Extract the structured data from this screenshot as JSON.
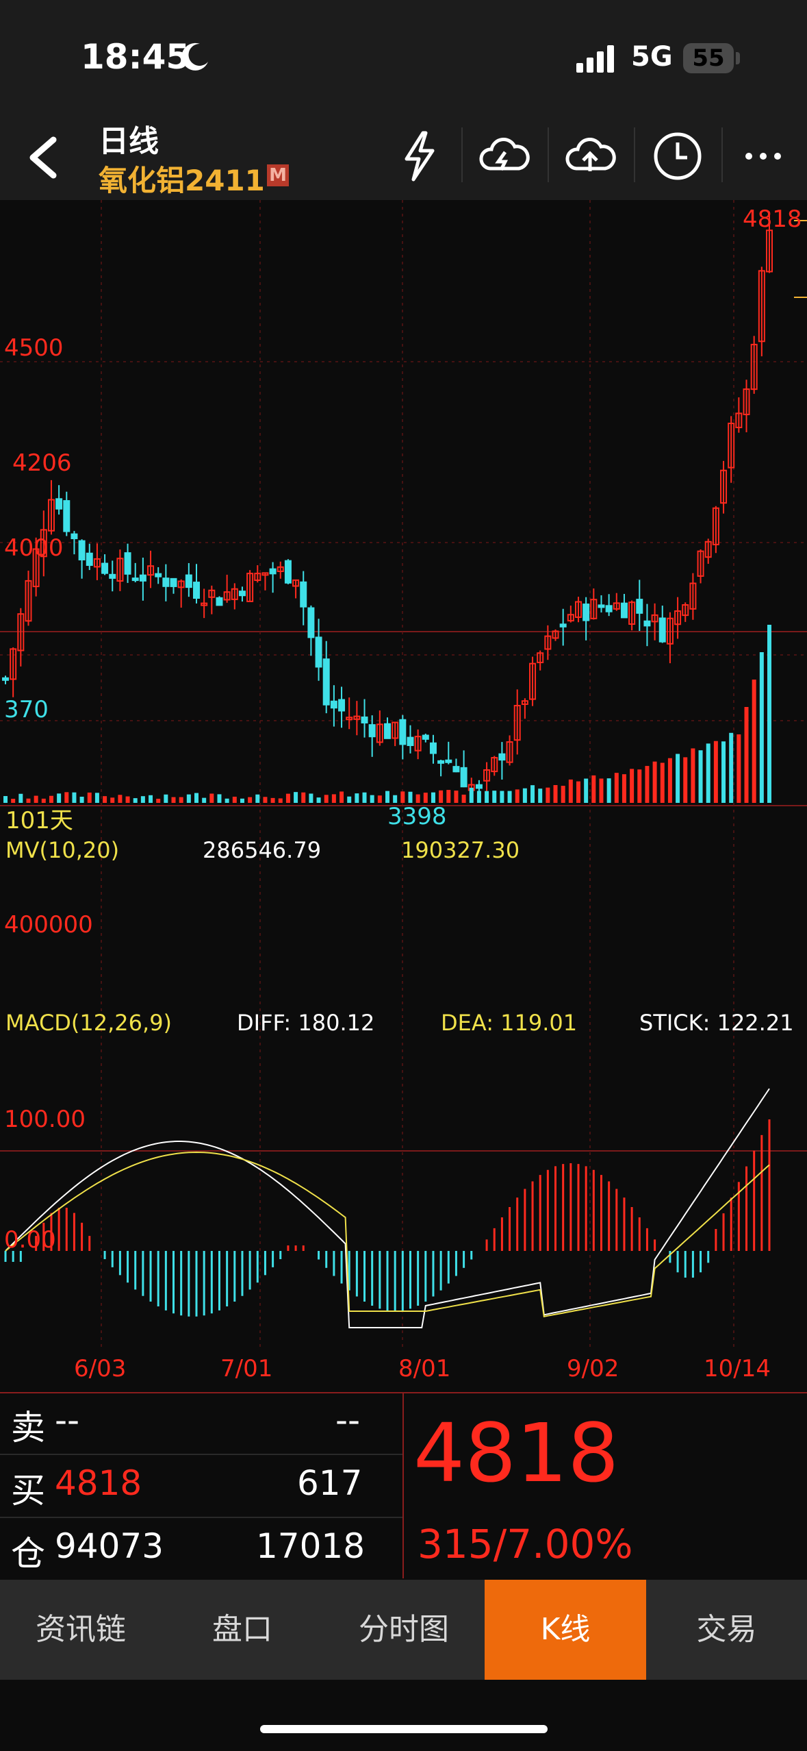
{
  "status_bar": {
    "time": "18:45",
    "network": "5G",
    "battery": "55"
  },
  "header": {
    "title": "日线",
    "instrument": "氧化铝2411",
    "badge": "M"
  },
  "price_chart": {
    "price_levels": [
      "4818",
      "4500",
      "4206",
      "4000",
      "370"
    ],
    "low_label": "3398",
    "days_label": "101天"
  },
  "volume": {
    "indicator": "MV(10,20)",
    "mv10": "286546.79",
    "mv20": "190327.30",
    "level": "400000"
  },
  "macd": {
    "indicator": "MACD(12,26,9)",
    "diff": "DIFF: 180.12",
    "dea": "DEA: 119.01",
    "stick": "STICK: 122.21",
    "level_100": "100.00",
    "level_0": "0.00"
  },
  "dates": [
    "6/03",
    "7/01",
    "8/01",
    "9/02",
    "10/14"
  ],
  "quote": {
    "sell_label": "卖",
    "sell_price": "--",
    "sell_qty": "--",
    "buy_label": "买",
    "buy_price": "4818",
    "buy_qty": "617",
    "oi_label": "仓",
    "oi_value": "94073",
    "oi_change": "17018",
    "last_price": "4818",
    "change": "315/7.00%"
  },
  "nav": {
    "tabs": [
      "资讯链",
      "盘口",
      "分时图",
      "K线",
      "交易"
    ],
    "active": "K线"
  },
  "colors": {
    "up": "#ff2a1e",
    "down": "#3fe0e8",
    "accent": "#ee6a0c",
    "title": "#f2b233"
  }
}
